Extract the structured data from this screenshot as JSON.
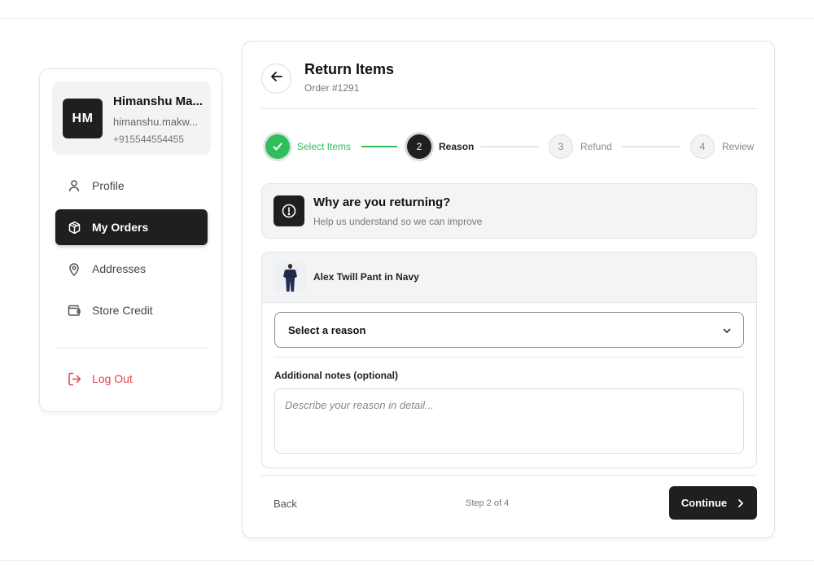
{
  "user": {
    "initials": "HM",
    "name": "Himanshu Ma...",
    "email": "himanshu.makw...",
    "phone": "+915544554455"
  },
  "sidebar": {
    "items": [
      {
        "label": "Profile",
        "icon": "user-icon"
      },
      {
        "label": "My Orders",
        "icon": "package-icon",
        "active": true
      },
      {
        "label": "Addresses",
        "icon": "map-pin-icon"
      },
      {
        "label": "Store Credit",
        "icon": "wallet-icon"
      }
    ],
    "logout_label": "Log Out"
  },
  "header": {
    "title": "Return Items",
    "order": "Order #1291"
  },
  "stepper": {
    "steps": [
      {
        "number": "",
        "label": "Select Items",
        "state": "done"
      },
      {
        "number": "2",
        "label": "Reason",
        "state": "current"
      },
      {
        "number": "3",
        "label": "Refund",
        "state": "pending"
      },
      {
        "number": "4",
        "label": "Review",
        "state": "pending"
      }
    ]
  },
  "why": {
    "title": "Why are you returning?",
    "subtitle": "Help us understand so we can improve"
  },
  "item": {
    "name": "Alex Twill Pant in Navy"
  },
  "form": {
    "reason_select": "Select a reason",
    "notes_label": "Additional notes (optional)",
    "notes_placeholder": "Describe your reason in detail..."
  },
  "footer": {
    "back_label": "Back",
    "step_count": "Step 2 of 4",
    "continue_label": "Continue"
  },
  "colors": {
    "accent_green": "#2fbe5c",
    "dark": "#1f1f1f",
    "danger": "#e04545"
  }
}
